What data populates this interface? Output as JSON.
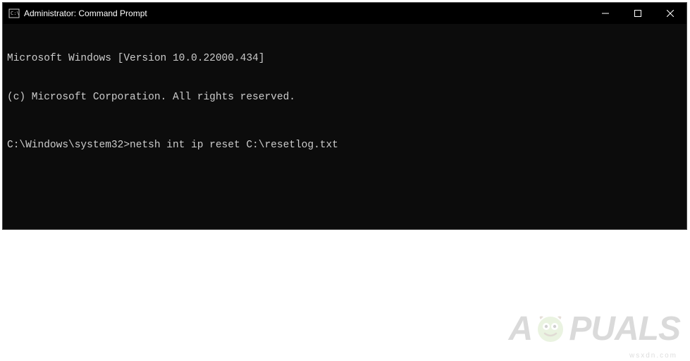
{
  "window": {
    "title": "Administrator: Command Prompt"
  },
  "terminal": {
    "line1": "Microsoft Windows [Version 10.0.22000.434]",
    "line2": "(c) Microsoft Corporation. All rights reserved.",
    "prompt": "C:\\Windows\\system32>",
    "command": "netsh int ip reset C:\\resetlog.txt"
  },
  "watermark": {
    "prefix": "A",
    "suffix": "PUALS",
    "sub": "wsxdn.com"
  }
}
